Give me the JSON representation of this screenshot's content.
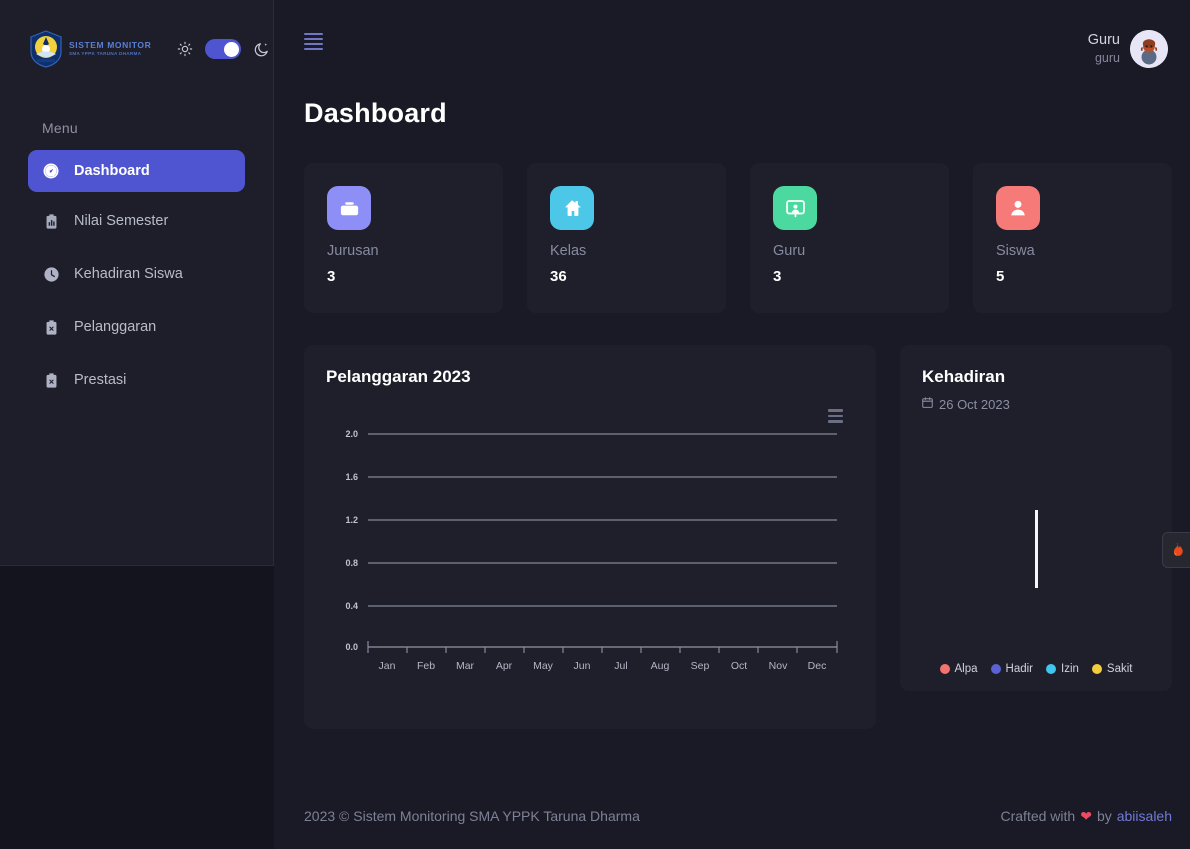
{
  "brand": {
    "logo_icon": "school-crest-logo",
    "title": "SISTEM MONITOR",
    "subtitle": "SMA YPPK TARUNA DHARMA"
  },
  "theme_toggle": {
    "light_icon": "sun-icon",
    "dark_icon": "moon-star-icon",
    "state": "on",
    "accent": "#4f55d1"
  },
  "sidebar": {
    "section_label": "Menu",
    "items": [
      {
        "label": "Dashboard",
        "icon": "gauge-icon",
        "active": true
      },
      {
        "label": "Nilai Semester",
        "icon": "clipboard-chart-icon",
        "active": false
      },
      {
        "label": "Kehadiran Siswa",
        "icon": "clock-icon",
        "active": false
      },
      {
        "label": "Pelanggaran",
        "icon": "clipboard-x-icon",
        "active": false
      },
      {
        "label": "Prestasi",
        "icon": "clipboard-star-icon",
        "active": false
      }
    ]
  },
  "topbar": {
    "menu_icon": "hamburger-menu-icon",
    "user_name": "Guru",
    "user_role": "guru",
    "avatar_icon": "user-avatar"
  },
  "header": {
    "title": "Dashboard"
  },
  "stats": [
    {
      "label": "Jurusan",
      "value": "3",
      "icon": "briefcase-icon",
      "color": "#8e8ef7"
    },
    {
      "label": "Kelas",
      "value": "36",
      "icon": "home-icon",
      "color": "#4cc7e8"
    },
    {
      "label": "Guru",
      "value": "3",
      "icon": "teacher-board-icon",
      "color": "#4cd9a0"
    },
    {
      "label": "Siswa",
      "value": "5",
      "icon": "user-icon",
      "color": "#f57a78"
    }
  ],
  "violation_panel": {
    "title": "Pelanggaran 2023",
    "menu_icon": "chart-menu-icon"
  },
  "attendance_panel": {
    "title": "Kehadiran",
    "date": "26 Oct 2023",
    "calendar_icon": "calendar-icon",
    "legend": [
      {
        "label": "Alpa",
        "color": "#f4736e"
      },
      {
        "label": "Hadir",
        "color": "#5b62d6"
      },
      {
        "label": "Izin",
        "color": "#3fc6ef"
      },
      {
        "label": "Sakit",
        "color": "#f2cd3c"
      }
    ]
  },
  "footer": {
    "copyright": "2023 © Sistem Monitoring SMA YPPK Taruna Dharma",
    "crafted_prefix": "Crafted with",
    "heart": "❤",
    "crafted_mid": "by",
    "author": "abiisaleh"
  },
  "side_widget": {
    "icon": "flame-icon"
  },
  "chart_data": [
    {
      "type": "line",
      "title": "Pelanggaran 2023",
      "categories": [
        "Jan",
        "Feb",
        "Mar",
        "Apr",
        "May",
        "Jun",
        "Jul",
        "Aug",
        "Sep",
        "Oct",
        "Nov",
        "Dec"
      ],
      "series": [
        {
          "name": "Pelanggaran",
          "values": [
            0,
            0,
            0,
            0,
            0,
            0,
            0,
            0,
            0,
            0,
            0,
            0
          ]
        }
      ],
      "yticks": [
        "0.0",
        "0.4",
        "0.8",
        "1.2",
        "1.6",
        "2.0"
      ],
      "ylim": [
        0,
        2
      ],
      "xlabel": "",
      "ylabel": "",
      "grid": true,
      "legend": "none"
    },
    {
      "type": "pie",
      "title": "Kehadiran",
      "subtitle": "26 Oct 2023",
      "labels": [
        "Alpa",
        "Hadir",
        "Izin",
        "Sakit"
      ],
      "values": [
        0,
        0,
        0,
        0
      ],
      "colors": [
        "#f4736e",
        "#5b62d6",
        "#3fc6ef",
        "#f2cd3c"
      ],
      "legend": "bottom"
    }
  ]
}
